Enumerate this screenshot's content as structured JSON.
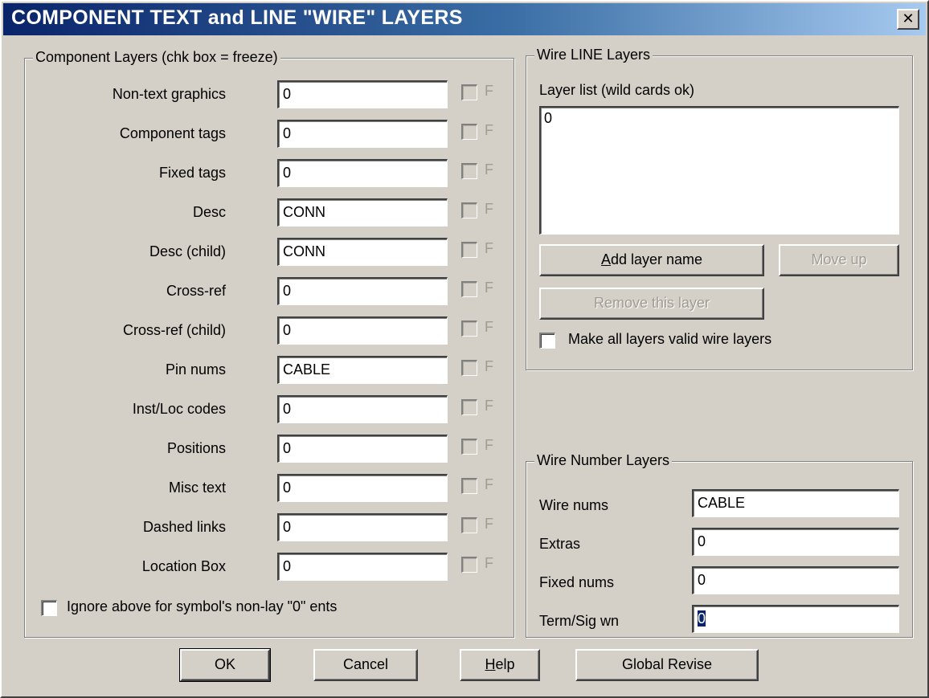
{
  "window": {
    "title": "COMPONENT TEXT and LINE \"WIRE\" LAYERS",
    "close_glyph": "✕"
  },
  "component_layers": {
    "legend": "Component Layers (chk box = freeze)",
    "freeze_letter": "F",
    "rows": [
      {
        "label": "Non-text graphics",
        "value": "0"
      },
      {
        "label": "Component tags",
        "value": "0"
      },
      {
        "label": "Fixed tags",
        "value": "0"
      },
      {
        "label": "Desc",
        "value": "CONN"
      },
      {
        "label": "Desc (child)",
        "value": "CONN"
      },
      {
        "label": "Cross-ref",
        "value": "0"
      },
      {
        "label": "Cross-ref (child)",
        "value": "0"
      },
      {
        "label": "Pin nums",
        "value": "CABLE"
      },
      {
        "label": "Inst/Loc codes",
        "value": "0"
      },
      {
        "label": "Positions",
        "value": "0"
      },
      {
        "label": "Misc text",
        "value": "0"
      },
      {
        "label": "Dashed links",
        "value": "0"
      },
      {
        "label": "Location Box",
        "value": "0"
      }
    ],
    "ignore_checkbox_label": "Ignore above for symbol's non-lay \"0\" ents"
  },
  "wire_line_layers": {
    "legend": "Wire LINE Layers",
    "list_label": "Layer list (wild cards ok)",
    "list_items": [
      "0"
    ],
    "add_button_mnemonic": "A",
    "add_button_rest": "dd layer name",
    "move_up_button": "Move up",
    "remove_button": "Remove this layer",
    "make_valid_label": "Make all layers valid wire layers"
  },
  "wire_number_layers": {
    "legend": "Wire Number Layers",
    "rows": [
      {
        "label": "Wire nums",
        "value": "CABLE"
      },
      {
        "label": "Extras",
        "value": "0"
      },
      {
        "label": "Fixed nums",
        "value": "0"
      },
      {
        "label": "Term/Sig wn",
        "value": "0"
      }
    ]
  },
  "buttons": {
    "ok": "OK",
    "cancel": "Cancel",
    "help_mnemonic": "H",
    "help_rest": "elp",
    "global_revise": "Global Revise"
  }
}
